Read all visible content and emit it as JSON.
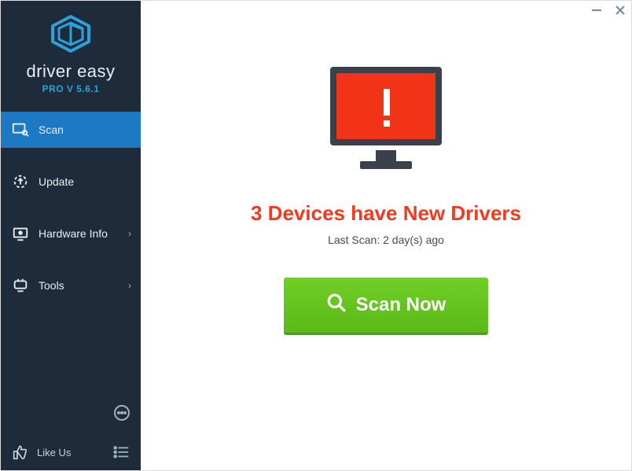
{
  "brand": {
    "name": "driver easy",
    "version_text": "PRO V 5.6.1"
  },
  "sidebar": {
    "items": [
      {
        "label": "Scan",
        "active": true
      },
      {
        "label": "Update"
      },
      {
        "label": "Hardware Info",
        "chevron": true
      },
      {
        "label": "Tools",
        "chevron": true
      }
    ],
    "like_label": "Like Us"
  },
  "main": {
    "headline": "3 Devices have New Drivers",
    "last_scan": "Last Scan: 2 day(s) ago",
    "scan_button": "Scan Now"
  }
}
